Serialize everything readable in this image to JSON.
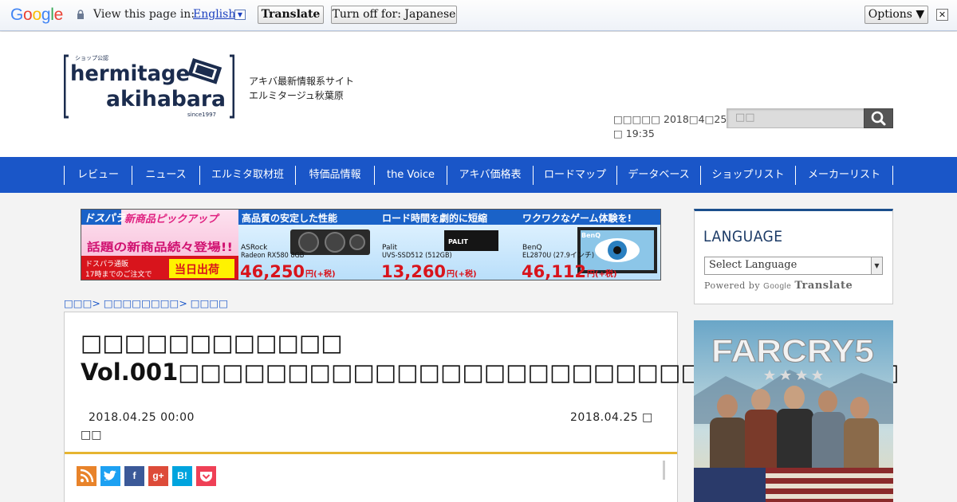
{
  "translate_bar": {
    "logo_letters": [
      {
        "ch": "G",
        "color": "#4285f4"
      },
      {
        "ch": "o",
        "color": "#ea4335"
      },
      {
        "ch": "o",
        "color": "#fbbc05"
      },
      {
        "ch": "g",
        "color": "#4285f4"
      },
      {
        "ch": "l",
        "color": "#34a853"
      },
      {
        "ch": "e",
        "color": "#ea4335"
      }
    ],
    "view_text": "View this page in:",
    "language": "English",
    "dropdown_glyph": "▼",
    "translate_label": "Translate",
    "turn_off_label": "Turn off for: Japanese",
    "options_label": "Options ▼",
    "close_glyph": "✕"
  },
  "header": {
    "logo": {
      "top_small": "ショップ公認",
      "line1": "hermitage",
      "line2": "akihabara",
      "since": "since1997"
    },
    "tagline_1": "アキバ最新情報系サイト",
    "tagline_2": "エルミタージュ秋葉原",
    "datetime_1": "□□□□□ 2018□4□25",
    "datetime_2": "□ 19:35",
    "search_placeholder": "□□"
  },
  "nav": {
    "items": [
      "レビュー",
      "ニュース",
      "エルミタ取材班",
      "特価品情報",
      "the Voice",
      "アキバ価格表",
      "ロードマップ",
      "データベース",
      "ショップリスト",
      "メーカーリスト"
    ]
  },
  "banner": {
    "brand": "ドスパラ",
    "pickup": "新商品ピックアップ",
    "headline": "話題の新商品続々登場!!",
    "shop_1": "ドスパラ通販",
    "shop_2": "17時までのご注文で",
    "same_day": "当日出荷",
    "products": [
      {
        "caption": "高品質の安定した性能",
        "name_1": "ASRock",
        "name_2": "Radeon RX580 8GB",
        "price": "46,250",
        "unit": "円(+税)"
      },
      {
        "caption": "ロード時間を劇的に短縮",
        "name_1": "Palit",
        "name_2": "UVS-SSD512 (512GB)",
        "price": "13,260",
        "unit": "円(+税)"
      },
      {
        "caption": "ワクワクなゲーム体験を!",
        "name_1": "BenQ",
        "name_2": "EL2870U (27.9インチ)",
        "price": "46,112",
        "unit": "円(+税)"
      }
    ],
    "ssd_label": "PALIT",
    "monitor_label": "BenQ"
  },
  "breadcrumb": "□□□> □□□□□□□□> □□□□",
  "article": {
    "title": "□□□□□□□□□□□□ Vol.001□□□□□□□□□□□□□□□□□□□□□□□□□□□□□□□□□",
    "date_posted": "2018.04.25 00:00",
    "date_updated": "2018.04.25 □",
    "date_suffix": "□□",
    "share_buttons": [
      {
        "name": "rss",
        "label": "",
        "color": "#e8832a"
      },
      {
        "name": "twitter",
        "label": "",
        "color": "#1da1f2"
      },
      {
        "name": "facebook",
        "label": "f",
        "color": "#3b5998"
      },
      {
        "name": "google-plus",
        "label": "g+",
        "color": "#dd4b39"
      },
      {
        "name": "hatena",
        "label": "B!",
        "color": "#00a4de"
      },
      {
        "name": "pocket",
        "label": "",
        "color": "#ef4056"
      }
    ]
  },
  "sidebar": {
    "language_title": "LANGUAGE",
    "select_label": "Select Language",
    "powered_by": "Powered by",
    "powered_brand": "Google",
    "powered_translate": "Translate",
    "ad_title": "FARCRY5"
  }
}
